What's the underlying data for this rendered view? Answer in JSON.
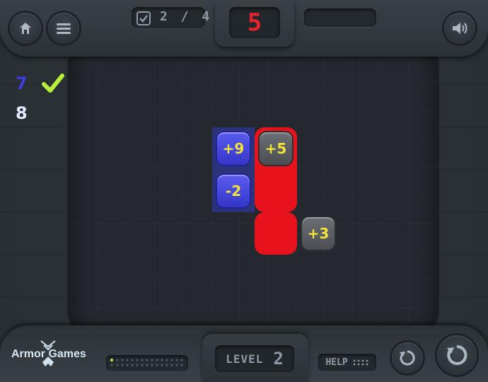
{
  "top": {
    "progress": "2 / 4",
    "moves": "5"
  },
  "targets": [
    {
      "value": "7",
      "done": true,
      "color": "#3b3ee0"
    },
    {
      "value": "8",
      "done": false,
      "color": "#e6e8ff"
    }
  ],
  "tiles": [
    {
      "label": "+9",
      "style": "blue"
    },
    {
      "label": "+5",
      "style": "grey-selected"
    },
    {
      "label": "-2",
      "style": "blue"
    },
    {
      "label": "+3",
      "style": "grey"
    }
  ],
  "bottom": {
    "logo": "Armor Games",
    "level_label": "LEVEL",
    "level_value": "2",
    "help_label": "HELP"
  },
  "icons": {
    "home": "home-icon",
    "menu": "menu-icon",
    "sound": "speaker-icon",
    "check": "checkmark-icon",
    "restart": "restart-icon",
    "undo": "undo-icon"
  },
  "colors": {
    "accent_red": "#e8121c",
    "tile_blue": "#4446dc",
    "tile_text": "#f3e23a",
    "check_green": "#b6f03a"
  }
}
